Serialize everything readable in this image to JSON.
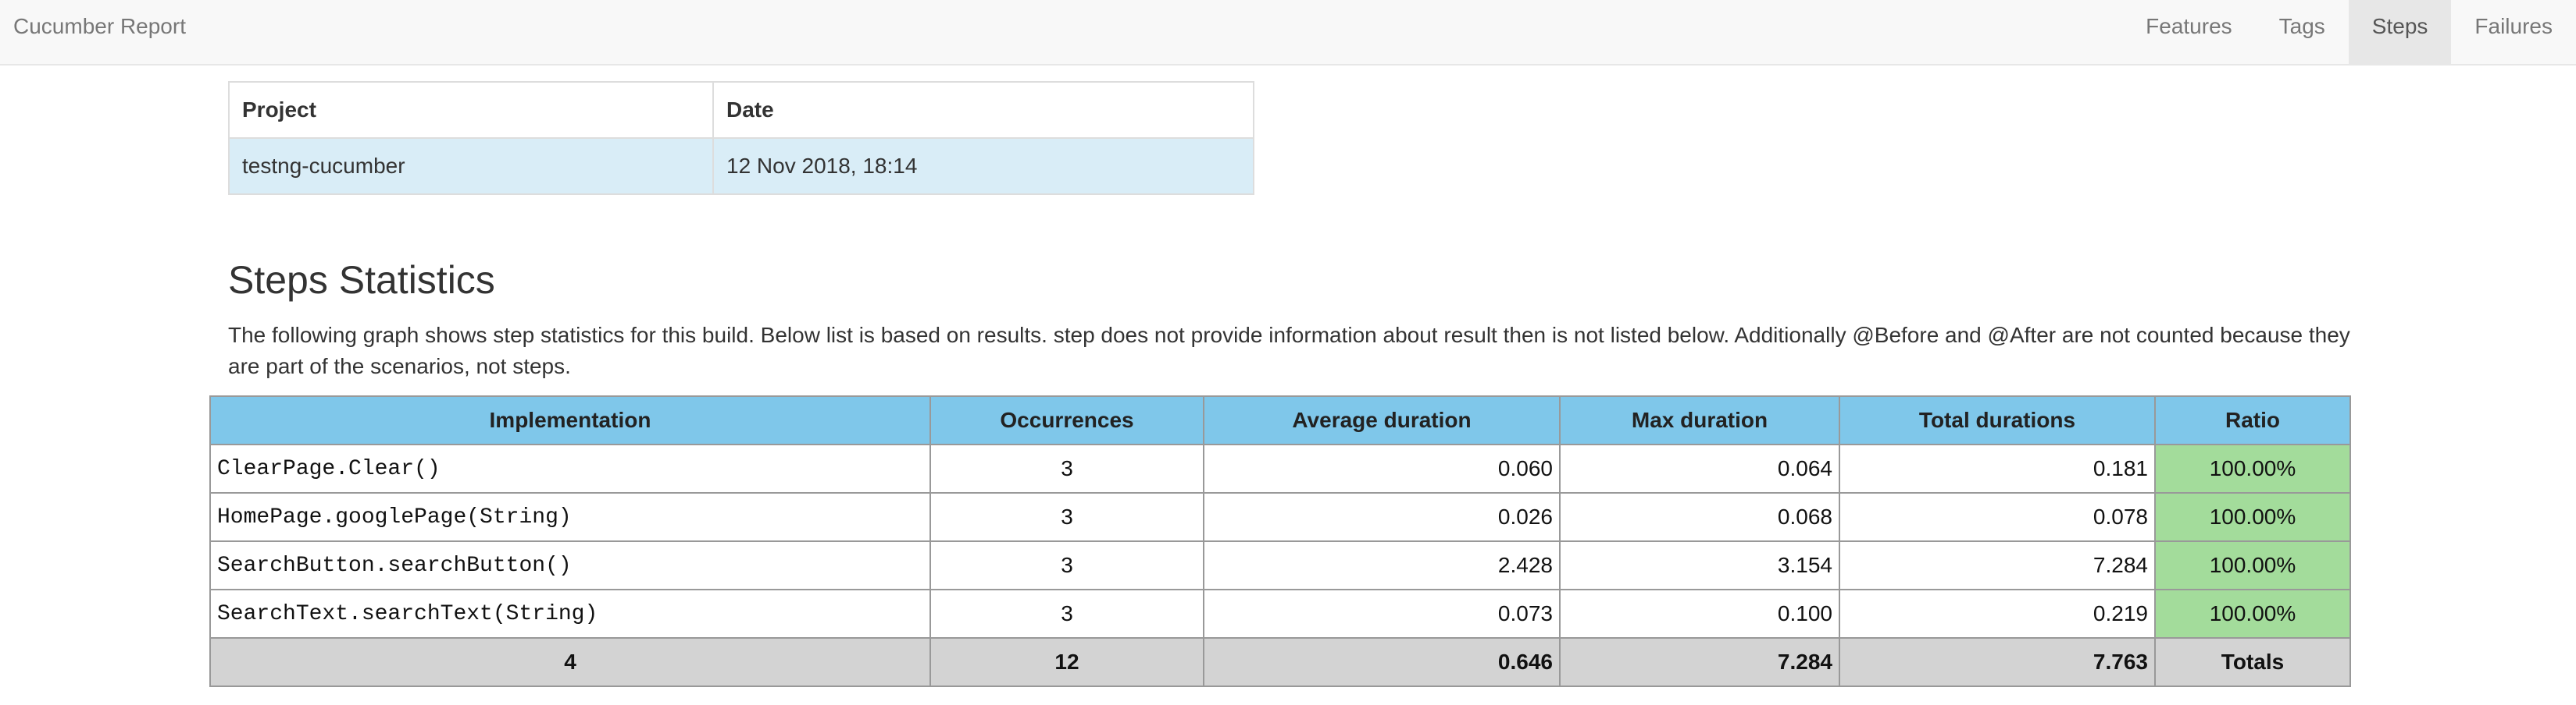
{
  "navbar": {
    "brand": "Cucumber Report",
    "items": [
      {
        "label": "Features"
      },
      {
        "label": "Tags"
      },
      {
        "label": "Steps"
      },
      {
        "label": "Failures"
      }
    ],
    "active": "Steps"
  },
  "project_table": {
    "headers": [
      "Project",
      "Date"
    ],
    "project": "testng-cucumber",
    "date": "12 Nov 2018, 18:14"
  },
  "section": {
    "title": "Steps Statistics",
    "description": "The following graph shows step statistics for this build. Below list is based on results. step does not provide information about result then is not listed below. Additionally @Before and @After are not counted because they are part of the scenarios, not steps."
  },
  "stats": {
    "headers": [
      "Implementation",
      "Occurrences",
      "Average duration",
      "Max duration",
      "Total durations",
      "Ratio"
    ],
    "rows": [
      {
        "implementation": "ClearPage.Clear()",
        "occurrences": "3",
        "average": "0.060",
        "max": "0.064",
        "total": "0.181",
        "ratio": "100.00%"
      },
      {
        "implementation": "HomePage.googlePage(String)",
        "occurrences": "3",
        "average": "0.026",
        "max": "0.068",
        "total": "0.078",
        "ratio": "100.00%"
      },
      {
        "implementation": "SearchButton.searchButton()",
        "occurrences": "3",
        "average": "2.428",
        "max": "3.154",
        "total": "7.284",
        "ratio": "100.00%"
      },
      {
        "implementation": "SearchText.searchText(String)",
        "occurrences": "3",
        "average": "0.073",
        "max": "0.100",
        "total": "0.219",
        "ratio": "100.00%"
      }
    ],
    "totals": {
      "implementation": "4",
      "occurrences": "12",
      "average": "0.646",
      "max": "7.284",
      "total": "7.763",
      "label": "Totals"
    },
    "colors": {
      "header": "#7fc7ea",
      "ratio": "#a3dc9b",
      "totals": "#d3d3d3"
    }
  }
}
